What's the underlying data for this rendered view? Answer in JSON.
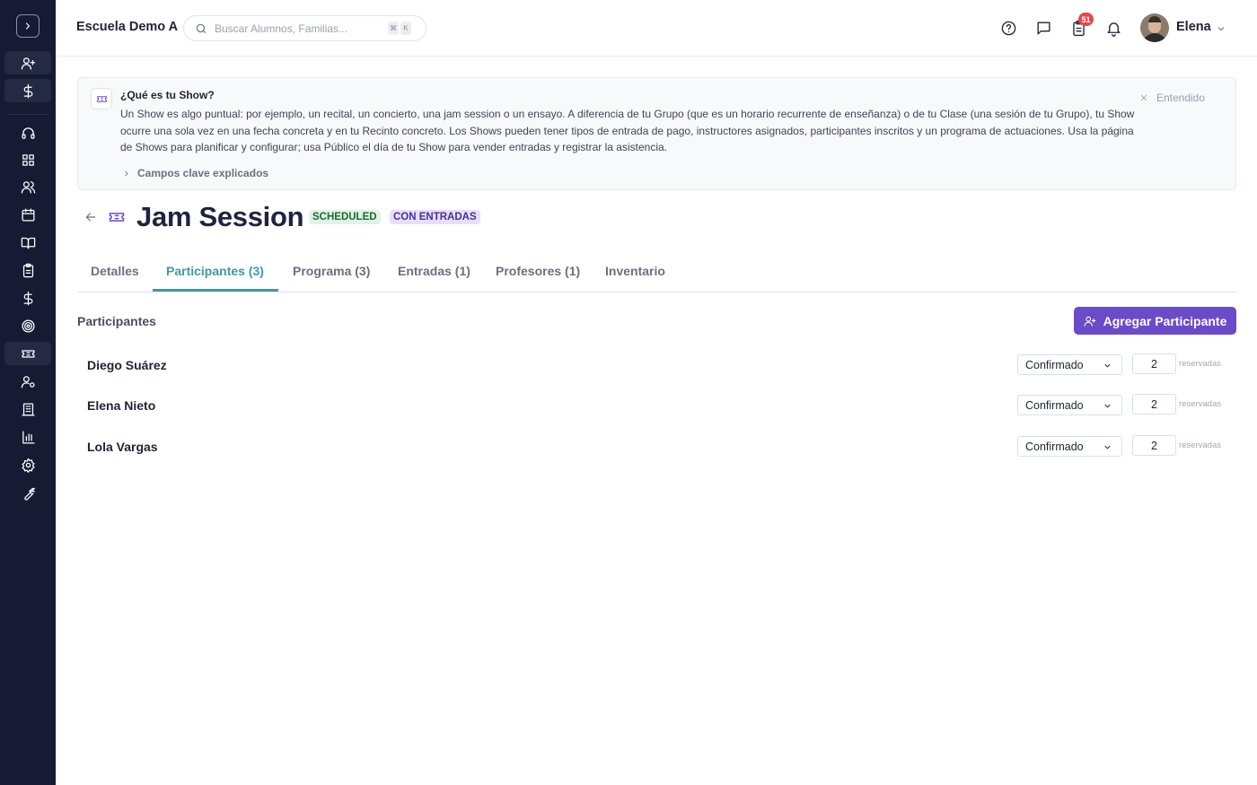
{
  "header": {
    "school_name": "Escuela Demo A",
    "search_placeholder": "Buscar Alumnos, Familias...",
    "kbd_keys": [
      "⌘",
      "K"
    ],
    "tasks_badge": "51",
    "user_name": "Elena"
  },
  "sidebar": {
    "icons": [
      "add-user-icon",
      "dollar-icon",
      "headset-icon",
      "grid-icon",
      "users-icon",
      "calendar-icon",
      "book-icon",
      "clipboard-icon",
      "dollar-icon",
      "target-icon",
      "ticket-icon",
      "user-settings-icon",
      "building-icon",
      "bar-chart-icon",
      "gear-icon",
      "wrench-icon"
    ]
  },
  "banner": {
    "title": "¿Qué es tu Show?",
    "text": "Un Show es algo puntual: por ejemplo, un recital, un concierto, una jam session o un ensayo. A diferencia de tu Grupo (que es un horario recurrente de enseñanza) o de tu Clase (una sesión de tu Grupo), tu Show ocurre una sola vez en una fecha concreta y en tu Recinto concreto. Los Shows pueden tener tipos de entrada de pago, instructores asignados, participantes inscritos y un programa de actuaciones. Usa la página de Shows para planificar y configurar; usa Público el día de tu Show para vender entradas y registrar la asistencia.",
    "dismiss_label": "Entendido",
    "more_label": "Campos clave explicados"
  },
  "show": {
    "title": "Jam Session",
    "status_badge": "SCHEDULED",
    "ticket_badge": "CON ENTRADAS"
  },
  "tabs": [
    {
      "label": "Detalles"
    },
    {
      "label": "Participantes (3)"
    },
    {
      "label": "Programa (3)"
    },
    {
      "label": "Entradas (1)"
    },
    {
      "label": "Profesores (1)"
    },
    {
      "label": "Inventario"
    }
  ],
  "active_tab": "Participantes (3)",
  "participants": {
    "section_title": "Participantes",
    "add_button": "Agregar Participante",
    "unit_label": "reservadas",
    "rows": [
      {
        "name": "Diego Suárez",
        "status": "Confirmado",
        "reserved": "2"
      },
      {
        "name": "Elena Nieto",
        "status": "Confirmado",
        "reserved": "2"
      },
      {
        "name": "Lola Vargas",
        "status": "Confirmado",
        "reserved": "2"
      }
    ]
  }
}
